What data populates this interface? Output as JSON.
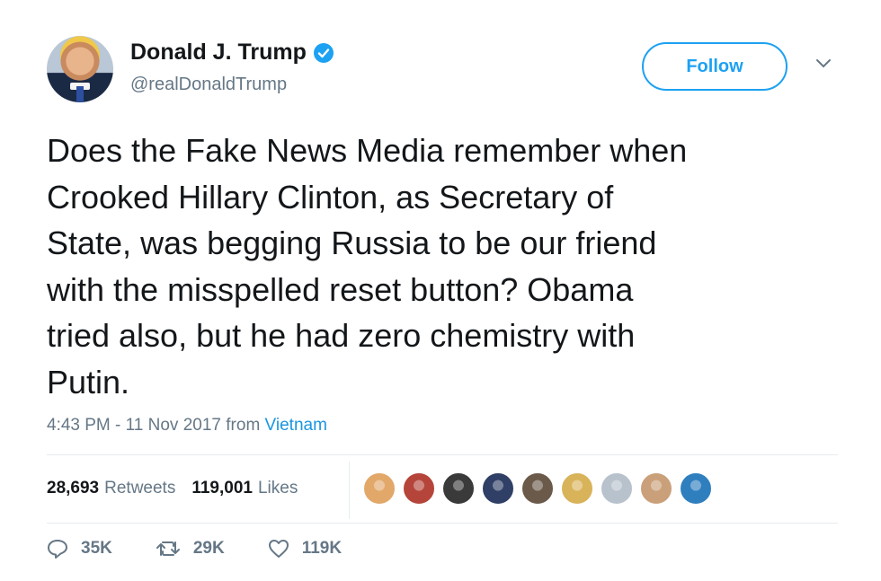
{
  "user": {
    "name": "Donald J. Trump",
    "handle": "@realDonaldTrump"
  },
  "follow_label": "Follow",
  "tweet": {
    "text": "Does the Fake News Media remember when\nCrooked Hillary Clinton, as Secretary of\nState, was begging Russia to be our friend\nwith the misspelled reset button? Obama\ntried also, but he had zero chemistry with\nPutin.",
    "timestamp": "4:43 PM - 11 Nov 2017",
    "from_label": "from",
    "place": "Vietnam"
  },
  "stats": {
    "retweets_count": "28,693",
    "retweets_label": "Retweets",
    "likes_count": "119,001",
    "likes_label": "Likes"
  },
  "likers": [
    {
      "icon": "liker-avatar",
      "color": "#e2a86a"
    },
    {
      "icon": "liker-avatar",
      "color": "#b5453a"
    },
    {
      "icon": "liker-avatar",
      "color": "#3a3a3a"
    },
    {
      "icon": "liker-avatar",
      "color": "#2f3f66"
    },
    {
      "icon": "liker-avatar",
      "color": "#6b5a4a"
    },
    {
      "icon": "liker-avatar",
      "color": "#d8b35a"
    },
    {
      "icon": "liker-avatar",
      "color": "#b8c2cc"
    },
    {
      "icon": "liker-avatar",
      "color": "#caa07a"
    },
    {
      "icon": "liker-avatar",
      "color": "#2f7fbf"
    }
  ],
  "actions": {
    "replies": "35K",
    "retweets": "29K",
    "likes": "119K"
  },
  "colors": {
    "accent": "#1da1f2",
    "muted": "#657786",
    "text": "#14171a"
  }
}
